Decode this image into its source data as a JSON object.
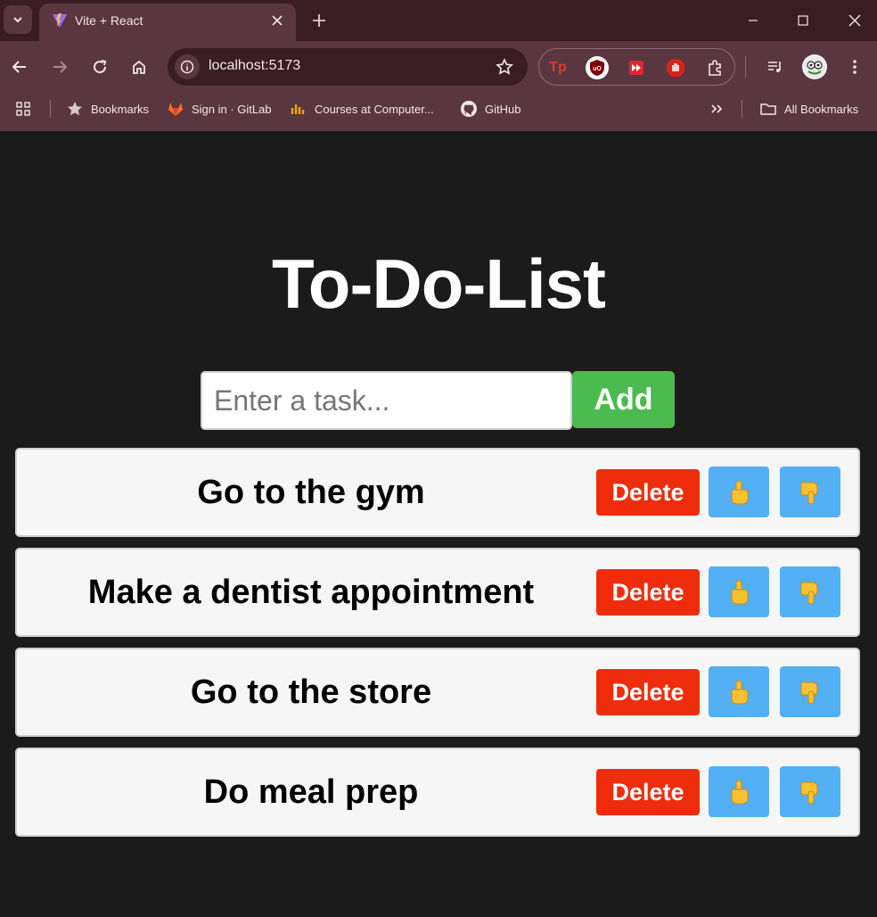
{
  "browser": {
    "tab_title": "Vite + React",
    "url": "localhost:5173",
    "bookmarks": [
      {
        "label": "Bookmarks",
        "icon": "star-icon"
      },
      {
        "label": "Sign in · GitLab",
        "icon": "gitlab-icon"
      },
      {
        "label": "Courses at Computer...",
        "icon": "courses-icon"
      },
      {
        "label": "GitHub",
        "icon": "github-icon"
      }
    ],
    "all_bookmarks_label": "All Bookmarks"
  },
  "app": {
    "title": "To-Do-List",
    "input_placeholder": "Enter a task...",
    "add_label": "Add",
    "tasks": [
      {
        "text": "Go to the gym",
        "delete_label": "Delete"
      },
      {
        "text": "Make a dentist appointment",
        "delete_label": "Delete"
      },
      {
        "text": "Go to the store",
        "delete_label": "Delete"
      },
      {
        "text": "Do meal prep",
        "delete_label": "Delete"
      }
    ]
  },
  "colors": {
    "page_bg": "#1c1b1b",
    "add_button": "#4cbb4f",
    "delete_button": "#ef2d0d",
    "move_button": "#53b0f4",
    "task_bg": "#f6f6f6",
    "chrome": "#5a3640"
  }
}
